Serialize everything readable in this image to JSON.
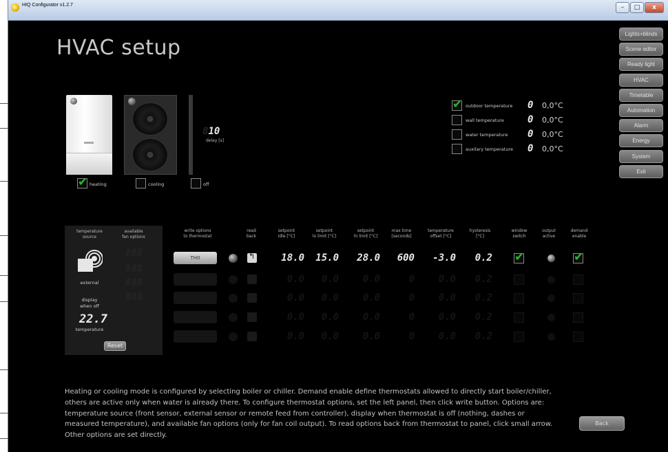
{
  "window": {
    "title": "HIQ Configurator v1.2.7",
    "minimize": "–",
    "maximize": "□",
    "close": "x"
  },
  "page_title": "HVAC setup",
  "menu": [
    "Lights+blinds",
    "Scene editor",
    "Ready light",
    "HVAC",
    "Timetable",
    "Automation",
    "Alarm",
    "Energy",
    "System",
    "Exit"
  ],
  "devices": {
    "heating": {
      "label": "heating",
      "checked": true
    },
    "cooling": {
      "label": "cooling",
      "checked": false
    },
    "off": {
      "label": "off",
      "checked": false
    },
    "delay_value": "10",
    "delay_ghost": "8",
    "delay_label": "delay [s]"
  },
  "sensors": [
    {
      "label": "outdoor temperature",
      "checked": true,
      "digit": "0",
      "value": "0,0°C"
    },
    {
      "label": "wall temperature",
      "checked": false,
      "digit": "0",
      "value": "0,0°C"
    },
    {
      "label": "water temperature",
      "checked": false,
      "digit": "0",
      "value": "0,0°C"
    },
    {
      "label": "auxilary temperature",
      "checked": false,
      "digit": "0",
      "value": "0,0°C"
    }
  ],
  "left_panel": {
    "col1": "temperature\nsource",
    "col2": "available\nfan options",
    "fan_digits": "888",
    "source_label": "external",
    "display_label": "display\nwhen off",
    "display_value": "22.7",
    "display_unit": "temperature",
    "reset_label": "Reset"
  },
  "table": {
    "headers": [
      "write options\nto thermostat",
      "read\nback",
      "setpoint\nidle [°C]",
      "setpoint\nlo limit [°C]",
      "setpoint\nhi limit [°C]",
      "max time\n[seconds]",
      "temperature\noffset [°C]",
      "hysteresis\n[°C]",
      "window\nswitch",
      "output\nactive",
      "demand\nenable"
    ],
    "rows": [
      {
        "button": "TH0",
        "active": true,
        "idle": "18.0",
        "lo": "15.0",
        "hi": "28.0",
        "max": "600",
        "offset": "-3.0",
        "hyst": "0.2",
        "window": true,
        "demand": true
      },
      {
        "button": "",
        "active": false,
        "idle": "0.0",
        "lo": "0.0",
        "hi": "0.0",
        "max": "0",
        "offset": "0.0",
        "hyst": "0.2",
        "window": false,
        "demand": false
      },
      {
        "button": "",
        "active": false,
        "idle": "0.0",
        "lo": "0.0",
        "hi": "0.0",
        "max": "0",
        "offset": "0.0",
        "hyst": "0.2",
        "window": false,
        "demand": false
      },
      {
        "button": "",
        "active": false,
        "idle": "0.0",
        "lo": "0.0",
        "hi": "0.0",
        "max": "0",
        "offset": "0.0",
        "hyst": "0.2",
        "window": false,
        "demand": false
      },
      {
        "button": "",
        "active": false,
        "idle": "0.0",
        "lo": "0.0",
        "hi": "0.0",
        "max": "0",
        "offset": "0.0",
        "hyst": "0.2",
        "window": false,
        "demand": false
      }
    ]
  },
  "help_text": "Heating or cooling mode is configured by selecting boiler or chiller. Demand enable define thermostats allowed to directly start boiler/chiller, others are active only when water is already there. To configure thermostat options, set the left panel, then click write button. Options are: temperature source (front sensor, external sensor or remote feed from controller), display when thermostat is off (nothing, dashes or measured temperature), and available fan options (only for fan coil output). To read options back from thermostat to panel, click small arrow. Other options are set directly.",
  "back_label": "Back",
  "colors": {
    "checkmark": "#29b82f",
    "background": "#000000",
    "heading": "#c9c9c9"
  }
}
